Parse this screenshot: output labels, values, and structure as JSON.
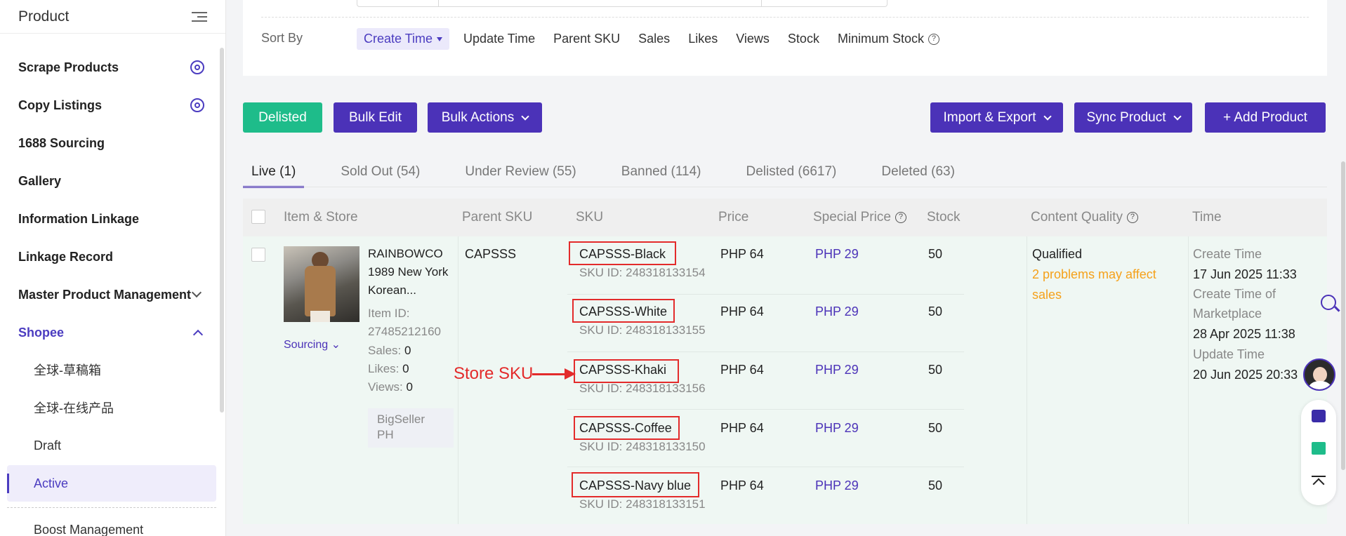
{
  "sidebar": {
    "title": "Product",
    "items": [
      {
        "label": "Scrape Products"
      },
      {
        "label": "Copy Listings"
      },
      {
        "label": "1688 Sourcing"
      },
      {
        "label": "Gallery"
      },
      {
        "label": "Information Linkage"
      },
      {
        "label": "Linkage Record"
      },
      {
        "label": "Master Product Management"
      },
      {
        "label": "Shopee"
      }
    ],
    "sub_items": [
      {
        "label": "全球-草稿箱"
      },
      {
        "label": "全球-在线产品"
      },
      {
        "label": "Draft"
      },
      {
        "label": "Active"
      },
      {
        "label": "Boost Management"
      }
    ]
  },
  "sort": {
    "label": "Sort By",
    "options": [
      "Create Time",
      "Update Time",
      "Parent SKU",
      "Sales",
      "Likes",
      "Views",
      "Stock",
      "Minimum Stock"
    ]
  },
  "toolbar": {
    "delisted": "Delisted",
    "bulk_edit": "Bulk Edit",
    "bulk_actions": "Bulk Actions",
    "import_export": "Import & Export",
    "sync_product": "Sync Product",
    "add_product": "+ Add Product"
  },
  "tabs": [
    {
      "label": "Live (1)"
    },
    {
      "label": "Sold Out (54)"
    },
    {
      "label": "Under Review (55)"
    },
    {
      "label": "Banned (114)"
    },
    {
      "label": "Delisted (6617)"
    },
    {
      "label": "Deleted (63)"
    }
  ],
  "table": {
    "headers": [
      "Item & Store",
      "Parent SKU",
      "SKU",
      "Price",
      "Special Price",
      "Stock",
      "Content Quality",
      "Time"
    ],
    "product": {
      "name_lines": [
        "RAINBOWCO",
        "1989 New York",
        "Korean..."
      ],
      "item_id_label": "Item ID:",
      "item_id": "27485212160",
      "sales": {
        "label": "Sales:",
        "value": "0"
      },
      "likes": {
        "label": "Likes:",
        "value": "0"
      },
      "views": {
        "label": "Views:",
        "value": "0"
      },
      "store_lines": [
        "BigSeller",
        "PH"
      ],
      "sourcing": "Sourcing",
      "parent_sku": "CAPSSS",
      "quality": "Qualified",
      "quality_note_lines": [
        "2 problems may affect",
        "sales"
      ],
      "time": {
        "create_label": "Create Time",
        "create": "17 Jun 2025 11:33",
        "market_label_lines": [
          "Create Time of",
          "Marketplace"
        ],
        "market": "28 Apr 2025 11:38",
        "update_label": "Update Time",
        "update": "20 Jun 2025 20:33"
      }
    },
    "variants": [
      {
        "sku": "CAPSSS-Black",
        "sku_id": "SKU ID: 248318133154",
        "price": "PHP 64",
        "special": "PHP 29",
        "stock": "50"
      },
      {
        "sku": "CAPSSS-White",
        "sku_id": "SKU ID: 248318133155",
        "price": "PHP 64",
        "special": "PHP 29",
        "stock": "50"
      },
      {
        "sku": "CAPSSS-Khaki",
        "sku_id": "SKU ID: 248318133156",
        "price": "PHP 64",
        "special": "PHP 29",
        "stock": "50"
      },
      {
        "sku": "CAPSSS-Coffee",
        "sku_id": "SKU ID: 248318133150",
        "price": "PHP 64",
        "special": "PHP 29",
        "stock": "50"
      },
      {
        "sku": "CAPSSS-Navy blue",
        "sku_id": "SKU ID: 248318133151",
        "price": "PHP 64",
        "special": "PHP 29",
        "stock": "50"
      }
    ]
  },
  "annotation": {
    "label": "Store SKU"
  },
  "colors": {
    "accent": "#4b32b8",
    "green": "#1ebc8a",
    "warning": "#f5a11b",
    "annotation": "#e32b2b"
  }
}
